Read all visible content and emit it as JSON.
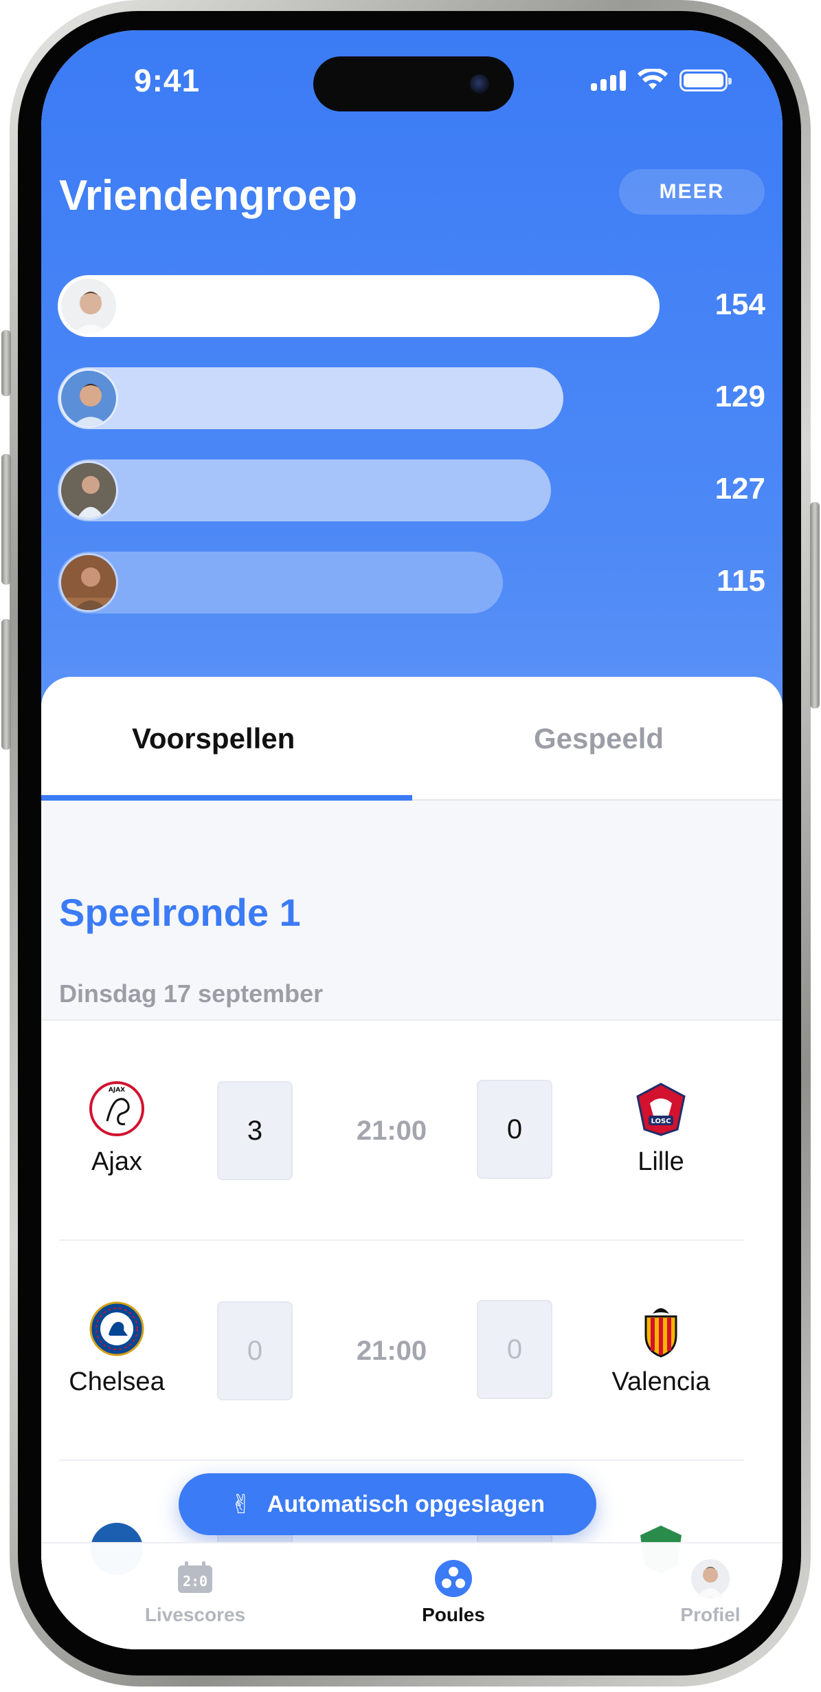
{
  "status_bar": {
    "time": "9:41"
  },
  "header": {
    "group_title": "Vriendengroep",
    "more_label": "MEER"
  },
  "ranking": [
    {
      "score": "154",
      "bar_fraction": 1.0,
      "bar_color": "#ffffff"
    },
    {
      "score": "129",
      "bar_fraction": 0.84,
      "bar_color": "#c9dafc"
    },
    {
      "score": "127",
      "bar_fraction": 0.82,
      "bar_color": "#a6c3fa"
    },
    {
      "score": "115",
      "bar_fraction": 0.74,
      "bar_color": "#82abf8"
    }
  ],
  "tabs": {
    "active": "Voorspellen",
    "inactive": "Gespeeld"
  },
  "round_title": "Speelronde 1",
  "date_label": "Dinsdag 17 september",
  "matches": [
    {
      "home": "Ajax",
      "away": "Lille",
      "time": "21:00",
      "home_score": "3",
      "away_score": "0"
    },
    {
      "home": "Chelsea",
      "away": "Valencia",
      "time": "21:00",
      "home_score": "0",
      "away_score": "0"
    }
  ],
  "toast": {
    "icon": "victory-hand-icon",
    "text": "Automatisch opgeslagen"
  },
  "tabbar": {
    "livescores": "Livescores",
    "poules": "Poules",
    "profiel": "Profiel"
  },
  "colors": {
    "accent": "#3b7bf5",
    "text": "#111111",
    "muted": "#9b9ea6"
  }
}
